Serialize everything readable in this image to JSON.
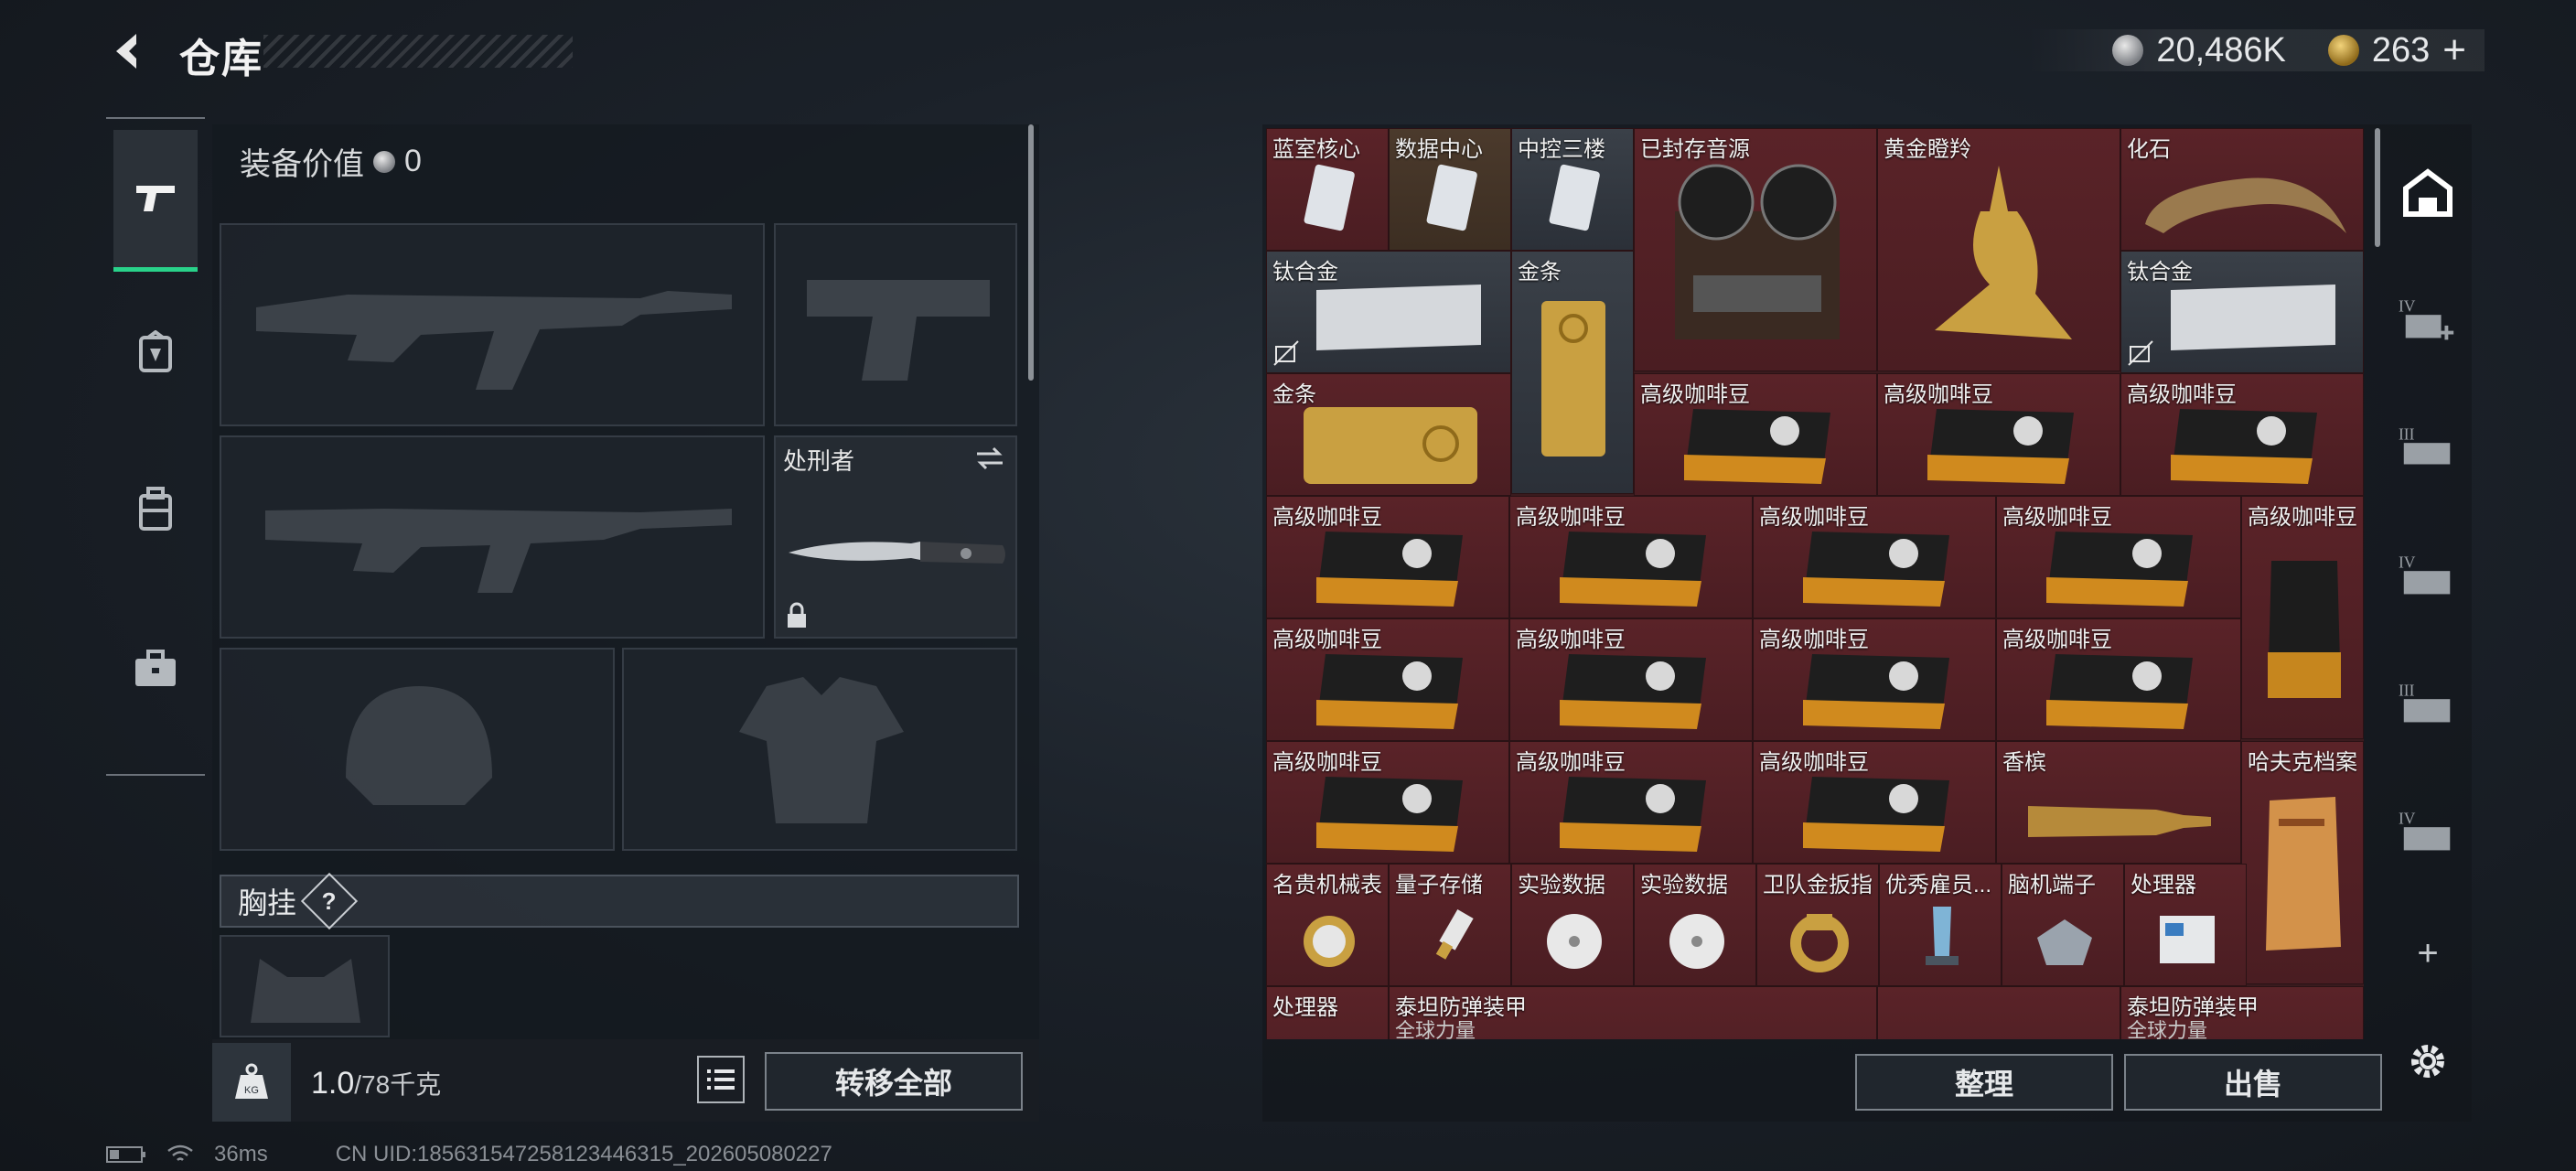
{
  "header": {
    "title": "仓库",
    "silver_amount": "20,486K",
    "gold_amount": "263",
    "add_label": "+"
  },
  "equipment": {
    "value_label": "装备价值",
    "value": "0",
    "knife_slot_label": "处刑者",
    "chest_label": "胸挂",
    "chest_help": "?",
    "weight_current": "1.0",
    "weight_max": "/78千克",
    "bag_label": "KG",
    "transfer_all_label": "转移全部"
  },
  "nav": {
    "items": [
      "weapon-icon",
      "armor-icon",
      "backpack-icon",
      "toolbox-icon"
    ]
  },
  "storage": {
    "items": [
      {
        "name": "蓝室核心"
      },
      {
        "name": "数据中心"
      },
      {
        "name": "中控三楼"
      },
      {
        "name": "已封存音源"
      },
      {
        "name": "黄金瞪羚"
      },
      {
        "name": "化石"
      },
      {
        "name": "钛合金"
      },
      {
        "name": "金条"
      },
      {
        "name": "钛合金"
      },
      {
        "name": "金条"
      },
      {
        "name": "高级咖啡豆"
      },
      {
        "name": "高级咖啡豆"
      },
      {
        "name": "高级咖啡豆"
      },
      {
        "name": "高级咖啡豆"
      },
      {
        "name": "高级咖啡豆"
      },
      {
        "name": "高级咖啡豆"
      },
      {
        "name": "高级咖啡豆"
      },
      {
        "name": "高级咖啡豆"
      },
      {
        "name": "高级咖啡豆"
      },
      {
        "name": "高级咖啡豆"
      },
      {
        "name": "高级咖啡豆"
      },
      {
        "name": "高级咖啡豆"
      },
      {
        "name": "高级咖啡豆"
      },
      {
        "name": "高级咖啡豆"
      },
      {
        "name": "高级咖啡豆"
      },
      {
        "name": "香槟"
      },
      {
        "name": "哈夫克档案"
      },
      {
        "name": "名贵机械表"
      },
      {
        "name": "量子存储"
      },
      {
        "name": "实验数据"
      },
      {
        "name": "实验数据"
      },
      {
        "name": "卫队金扳指"
      },
      {
        "name": "优秀雇员..."
      },
      {
        "name": "脑机端子"
      },
      {
        "name": "处理器"
      },
      {
        "name": "处理器"
      },
      {
        "name": "泰坦防弹装甲",
        "sub": "全球力量"
      },
      {
        "name": "泰坦防弹装甲",
        "sub": "全球力量"
      }
    ],
    "sort_label": "整理",
    "sell_label": "出售",
    "side_add": "+"
  },
  "status": {
    "ping": "36ms",
    "uid": "CN UID:185631547258123446315_202605080227"
  }
}
